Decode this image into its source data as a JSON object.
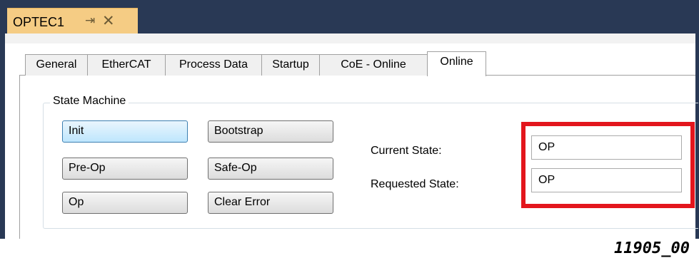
{
  "window": {
    "tab_title": "OPTEC1",
    "pin_glyph": "⇥",
    "close_glyph": "✕"
  },
  "tabs": [
    "General",
    "EtherCAT",
    "Process Data",
    "Startup",
    "CoE - Online",
    "Online"
  ],
  "active_tab": "Online",
  "state_machine": {
    "title": "State Machine",
    "buttons": [
      "Init",
      "Bootstrap",
      "Pre-Op",
      "Safe-Op",
      "Op",
      "Clear Error"
    ],
    "focused_button": "Init"
  },
  "state": {
    "current_label": "Current State:",
    "current_value": "OP",
    "requested_label": "Requested State:",
    "requested_value": "OP"
  },
  "annotation": {
    "highlight_color": "#e3161d",
    "figure_id": "11905_00"
  },
  "colors": {
    "titlebar": "#293955",
    "doc_tab": "#f5cc84"
  }
}
